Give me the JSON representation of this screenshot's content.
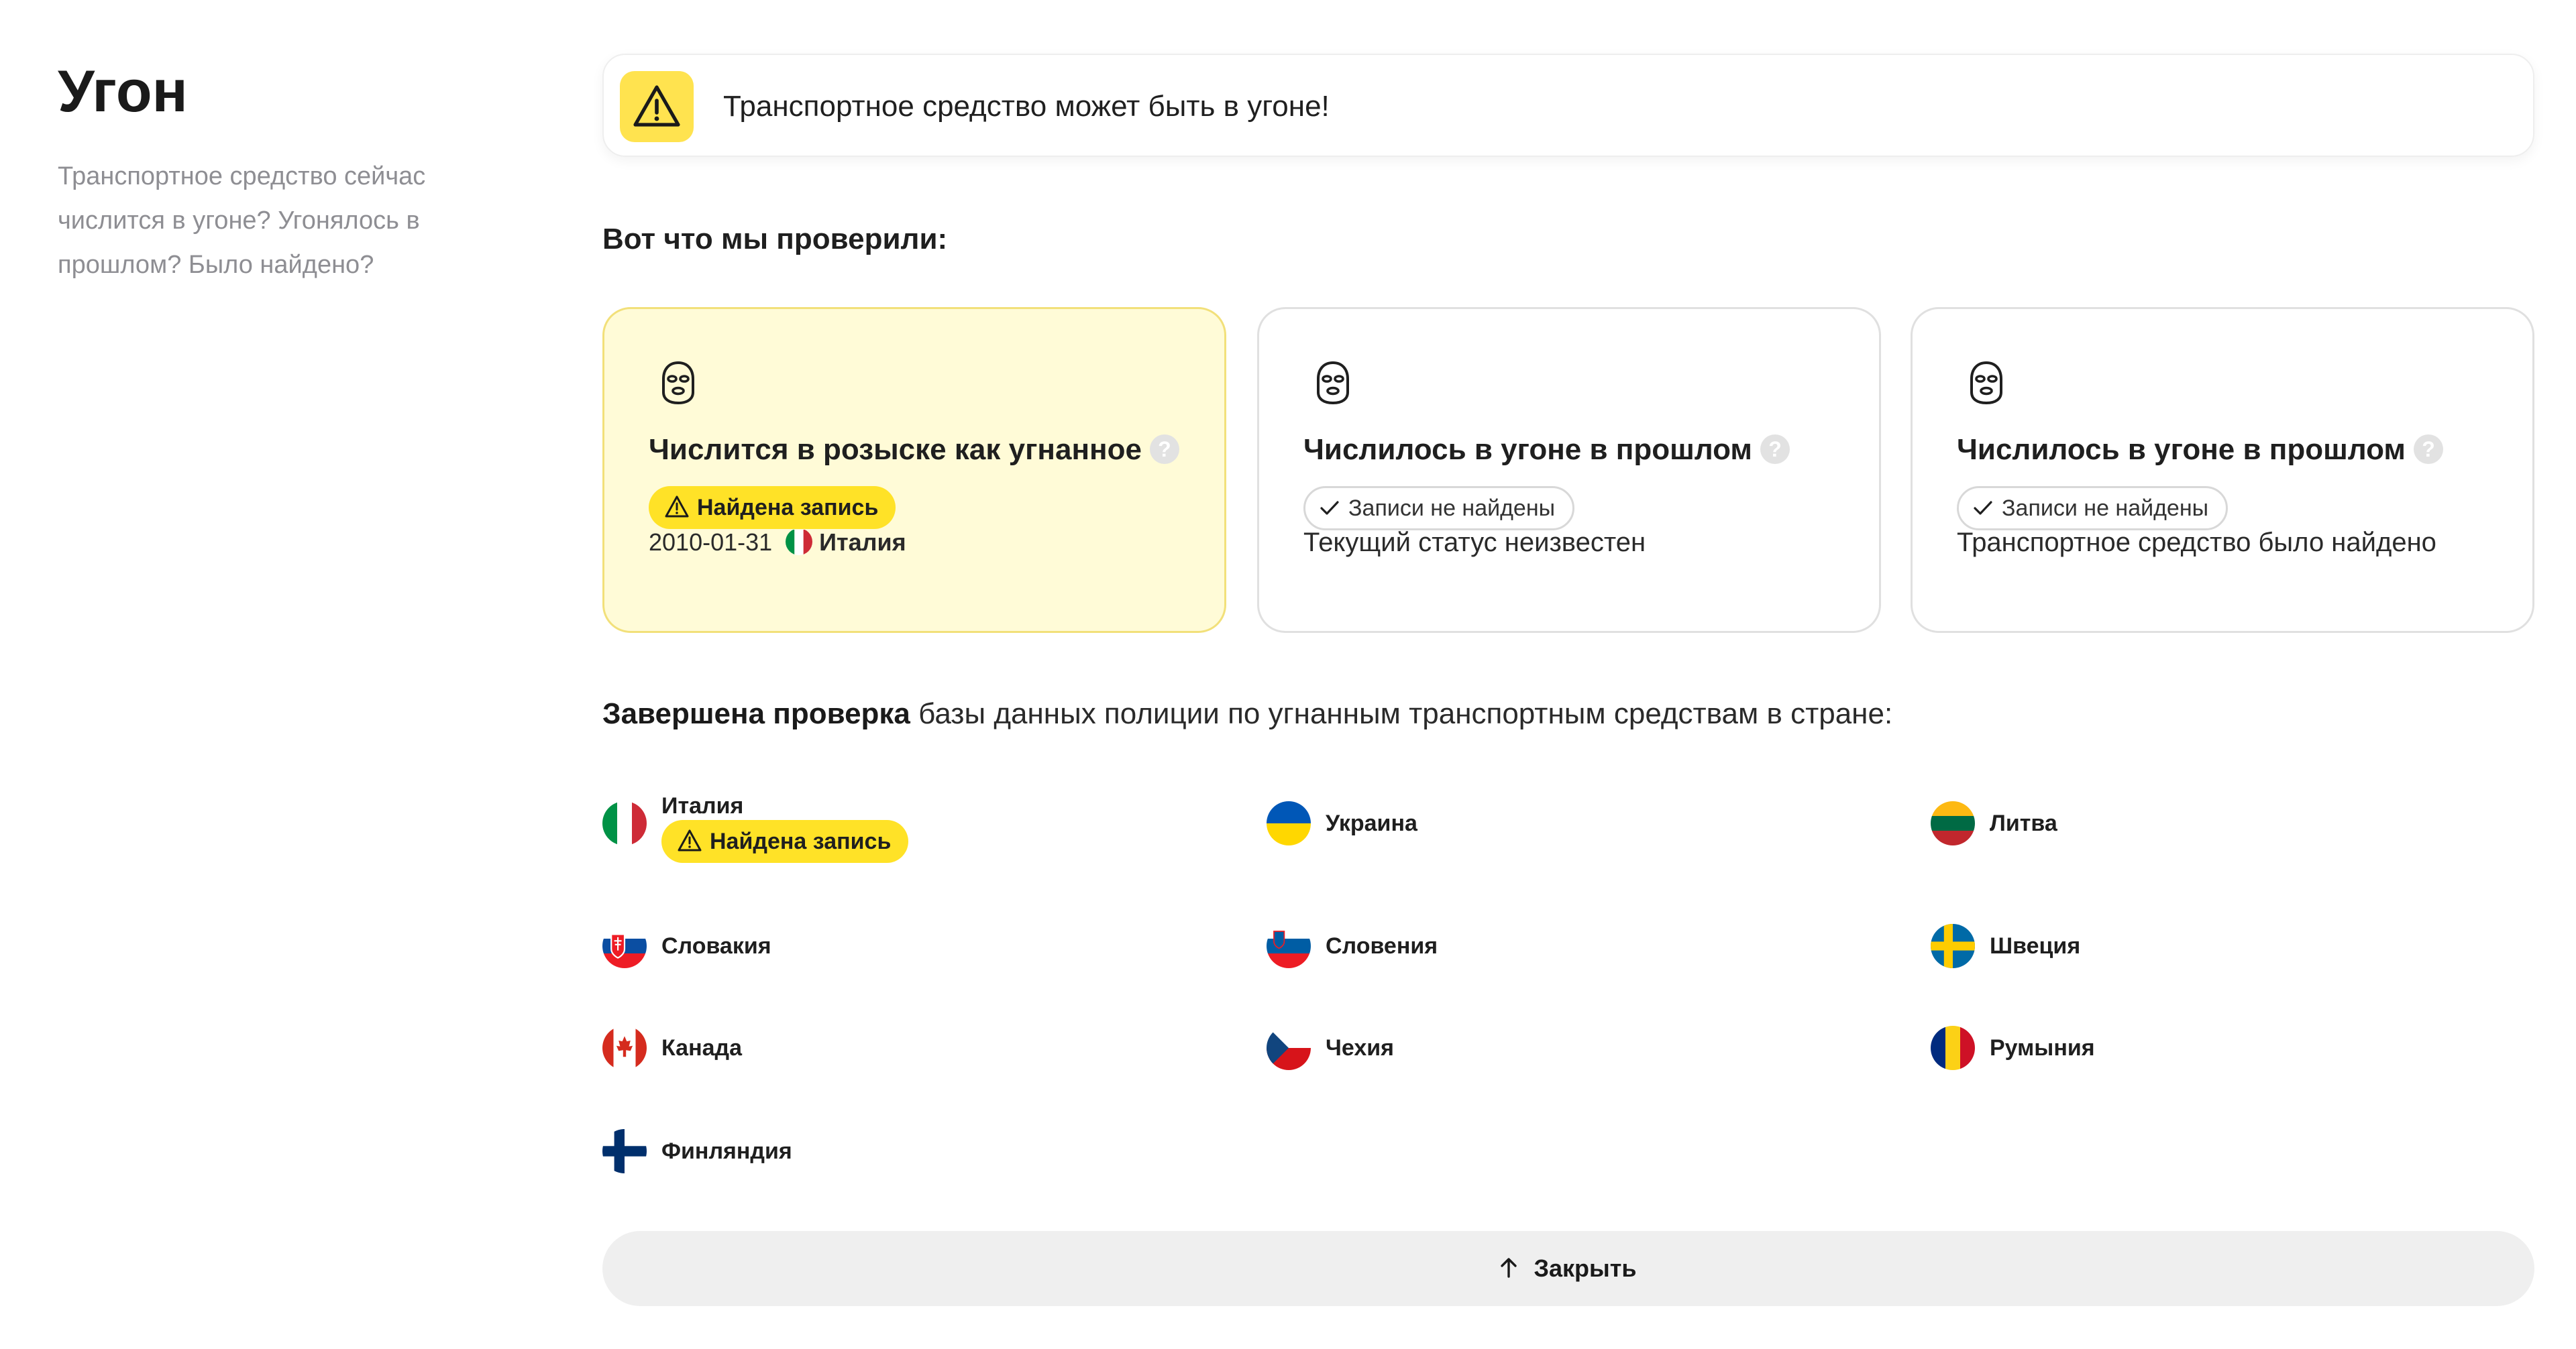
{
  "sidebar": {
    "title": "Угон",
    "description": "Транспортное средство сейчас числится в угоне? Угонялось в прошлом? Было найдено?"
  },
  "alert": {
    "text": "Транспортное средство может быть в угоне!",
    "icon": "warning-icon",
    "color": "#ffe34f"
  },
  "section_title": "Вот что мы проверили:",
  "cards": [
    {
      "title": "Числится в розыске как угнанное",
      "help": "?",
      "badge": "Найдена запись",
      "date": "2010-01-31",
      "country": "Италия",
      "icon": "balaclava-icon"
    },
    {
      "title": "Числилось в угоне в прошлом",
      "help": "?",
      "badge": "Записи не найдены",
      "status": "Текущий статус неизвестен",
      "icon": "balaclava-icon"
    },
    {
      "title": "Числилось в угоне в прошлом",
      "help": "?",
      "badge": "Записи не найдены",
      "status": "Транспортное средство было найдено",
      "icon": "balaclava-icon"
    }
  ],
  "completed": {
    "bold": "Завершена проверка",
    "rest": " базы данных полиции по угнанным транспортным средствам в стране:"
  },
  "countries": [
    {
      "name": "Италия",
      "badge": "Найдена запись"
    },
    {
      "name": "Украина"
    },
    {
      "name": "Литва"
    },
    {
      "name": "Словакия"
    },
    {
      "name": "Словения"
    },
    {
      "name": "Швеция"
    },
    {
      "name": "Канада"
    },
    {
      "name": "Чехия"
    },
    {
      "name": "Румыния"
    },
    {
      "name": "Финляндия"
    }
  ],
  "close_button": {
    "label": "Закрыть",
    "icon": "arrow-up-icon"
  },
  "colors": {
    "accent_yellow": "#ffe227",
    "warn_card_bg": "#fffbd7",
    "muted_text": "#8e8e93"
  }
}
